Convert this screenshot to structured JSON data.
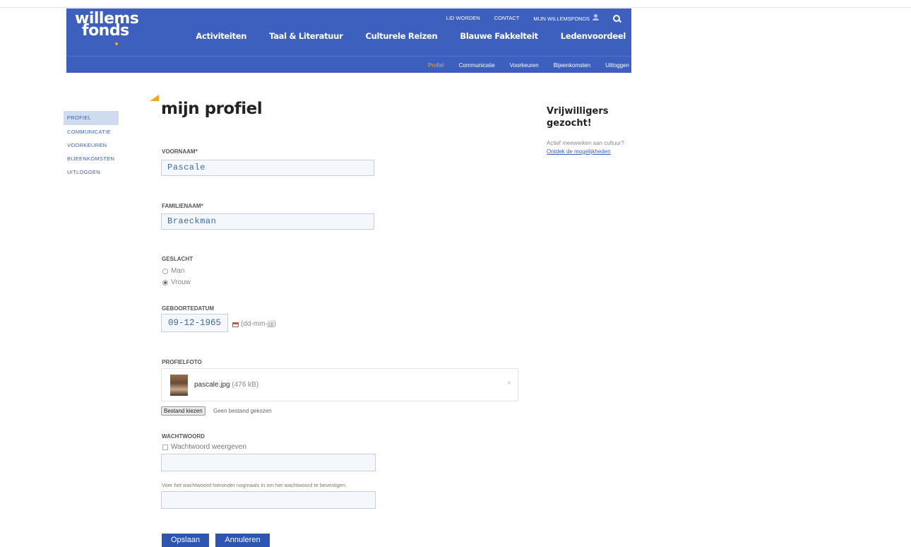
{
  "header": {
    "logo_line1": "willems",
    "logo_line2": "fonds",
    "util": {
      "lid_worden": "LID WORDEN",
      "contact": "CONTACT",
      "mijn": "MIJN WILLEMSFONDS"
    },
    "main_nav": [
      "Activiteiten",
      "Taal & Literatuur",
      "Culturele Reizen",
      "Blauwe Fakkelteit",
      "Ledenvoordeel"
    ],
    "sub_nav": [
      "Profiel",
      "Communicatie",
      "Voorkeuren",
      "Bijeenkomsten",
      "Uitloggen"
    ]
  },
  "sidebar": {
    "items": [
      "PROFIEL",
      "COMMUNICATIE",
      "VOORKEUREN",
      "BIJEENKOMSTEN",
      "UITLOGGEN"
    ]
  },
  "page_title": "mijn profiel",
  "form": {
    "voornaam_label": "VOORNAAM",
    "voornaam_value": "Pascale",
    "familienaam_label": "FAMILIENAAM",
    "familienaam_value": "Braeckman",
    "required_mark": "*",
    "geslacht_label": "GESLACHT",
    "geslacht_options": [
      "Man",
      "Vrouw"
    ],
    "geslacht_selected": "Vrouw",
    "geboortedatum_label": "GEBOORTEDATUM",
    "geboortedatum_value": "09-12-1965",
    "geboortedatum_hint": "(dd-mm-jjjj)",
    "profielfoto_label": "PROFIELFOTO",
    "photo_name": "pascale.jpg",
    "photo_size": "(476 kB)",
    "photo_remove": "×",
    "file_button": "Bestand kiezen",
    "file_status": "Geen bestand gekozen",
    "wachtwoord_label": "WACHTWOORD",
    "show_password_label": "Wachtwoord weergeven",
    "confirm_hint": "Voer het wachtwoord hieronder nogmaals in om het wachtwoord te bevestigen.",
    "save_button": "Opslaan",
    "cancel_button": "Annuleren"
  },
  "aside": {
    "title": "Vrijwilligers gezocht!",
    "text": "Actief meewerken aan cultuur?",
    "link": "Ontdek de mogelijkheden"
  },
  "colors": {
    "brand_blue": "#3d5fbd",
    "accent_orange": "#f5a623",
    "button_blue": "#2e55b0"
  }
}
